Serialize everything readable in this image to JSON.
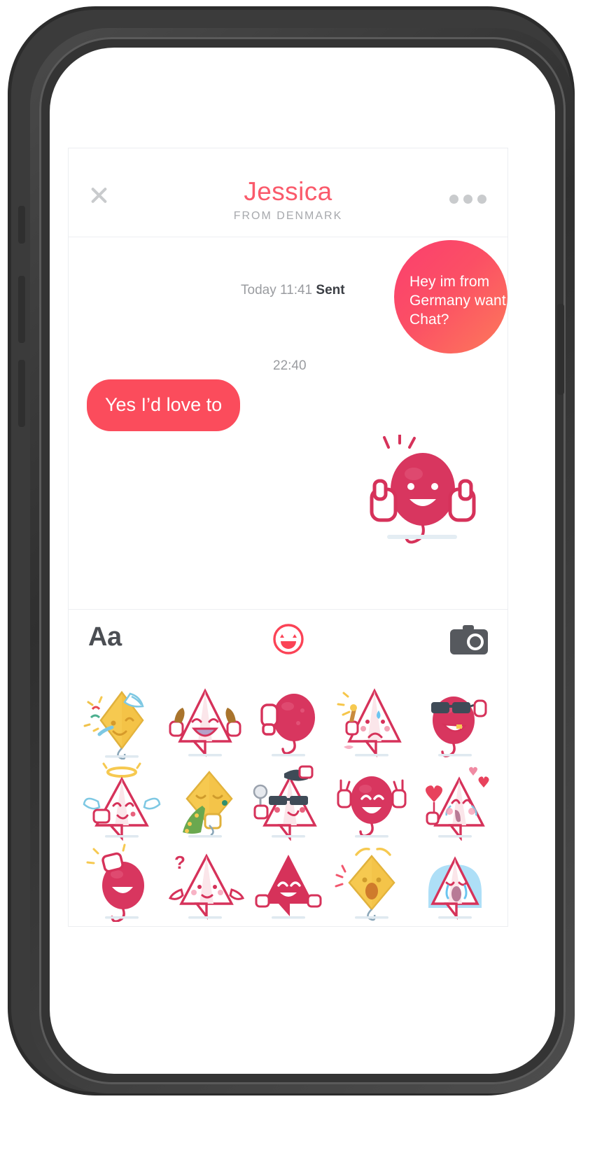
{
  "device": {
    "frame": "smartphone-mockup",
    "buttons": [
      "mute-switch",
      "volume-up",
      "volume-down",
      "power"
    ]
  },
  "app": {
    "header": {
      "close_icon": "close-icon",
      "name": "Jessica",
      "subtitle": "FROM DENMARK",
      "more_icon": "more-options-icon"
    },
    "conversation": {
      "messages": [
        {
          "meta_prefix": "Today 11:41 ",
          "meta_status": "Sent",
          "text": "Hey im from Germany want Chat?",
          "direction": "outgoing",
          "shape": "circle"
        },
        {
          "meta_prefix": "22:40",
          "meta_status": "",
          "text": "Yes I’d love to",
          "direction": "incoming",
          "shape": "rounded-bubble"
        },
        {
          "meta_prefix": "",
          "meta_status": "",
          "text": "",
          "direction": "incoming",
          "shape": "sticker",
          "sticker_name": "balloon-thumbs-up-sticker"
        }
      ]
    },
    "toolbar": {
      "text_label": "Aa",
      "emoji_icon": "smiley-face-icon",
      "camera_icon": "camera-icon"
    },
    "sticker_panel": {
      "rows": 3,
      "columns": 5,
      "stickers": [
        {
          "id": "kite-party-horn",
          "name": "kite-party-horn-sticker"
        },
        {
          "id": "triangle-chicken-legs",
          "name": "triangle-chicken-legs-sticker"
        },
        {
          "id": "balloon-phone",
          "name": "balloon-phone-sticker"
        },
        {
          "id": "triangle-sad-icecream",
          "name": "triangle-sad-icecream-sticker"
        },
        {
          "id": "balloon-sunglasses",
          "name": "balloon-sunglasses-sticker"
        },
        {
          "id": "triangle-angel",
          "name": "triangle-angel-sticker"
        },
        {
          "id": "kite-sick-vomit",
          "name": "kite-sick-vomit-sticker"
        },
        {
          "id": "triangle-selfie-shades",
          "name": "triangle-selfie-shades-sticker"
        },
        {
          "id": "balloon-peace-hands",
          "name": "balloon-peace-hands-sticker"
        },
        {
          "id": "triangle-love-hearts",
          "name": "triangle-love-hearts-sticker"
        },
        {
          "id": "balloon-camera-flash",
          "name": "balloon-camera-flash-sticker"
        },
        {
          "id": "triangle-question",
          "name": "triangle-question-sticker"
        },
        {
          "id": "triangle-solid-red",
          "name": "triangle-solid-red-sticker"
        },
        {
          "id": "kite-yellow-shout",
          "name": "kite-yellow-shout-sticker"
        },
        {
          "id": "triangle-crying-blue",
          "name": "triangle-crying-blue-sticker"
        }
      ]
    }
  },
  "colors": {
    "brand_pink": "#fa5a6b",
    "bubble_in": "#fb4c5c",
    "bubble_out_start": "#fb3f6e",
    "bubble_out_end": "#fd7a5a",
    "text_muted": "#9a9ca0",
    "text_dark": "#3b3e44",
    "sticker_outline": "#d6325a",
    "sticker_yellow": "#f6c950",
    "sticker_green": "#6aa84f",
    "sticker_blue": "#7ec8e3",
    "icon_gray": "#c9cbcd"
  }
}
